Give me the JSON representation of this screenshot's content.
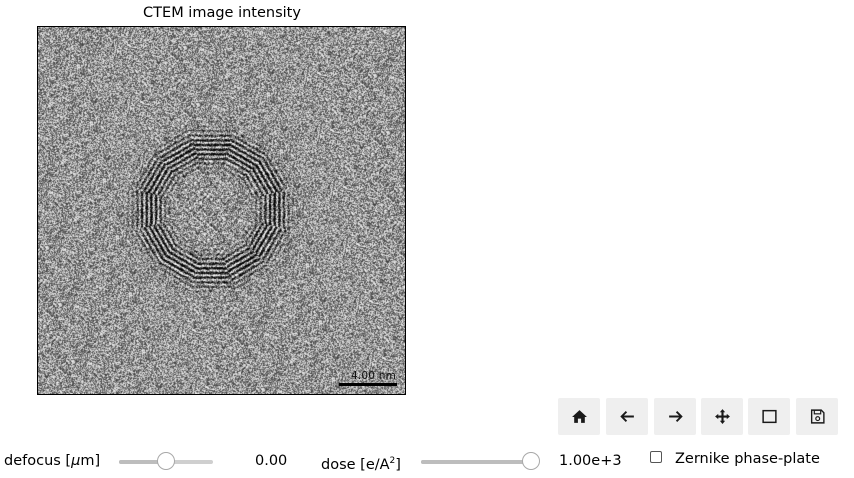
{
  "figure": {
    "title": "CTEM image intensity",
    "scalebar_label": "4.00 nm"
  },
  "toolbar": {
    "buttons": [
      {
        "name": "home",
        "icon": "home-icon"
      },
      {
        "name": "back",
        "icon": "arrow-left-icon"
      },
      {
        "name": "forward",
        "icon": "arrow-right-icon"
      },
      {
        "name": "pan",
        "icon": "move-icon"
      },
      {
        "name": "zoom",
        "icon": "zoom-rect-icon"
      },
      {
        "name": "save",
        "icon": "save-icon"
      }
    ]
  },
  "controls": {
    "defocus": {
      "label_prefix": "defocus [",
      "label_unit_symbol": "μ",
      "label_suffix": "m]",
      "value_text": "0.00",
      "position_fraction": 0.5
    },
    "dose": {
      "label_prefix": "dose [e/A",
      "label_superscript": "2",
      "label_suffix": "]",
      "value_text": "1.00e+3",
      "position_fraction": 1.0
    },
    "phase_plate": {
      "label": "Zernike phase-plate",
      "checked": false
    }
  }
}
